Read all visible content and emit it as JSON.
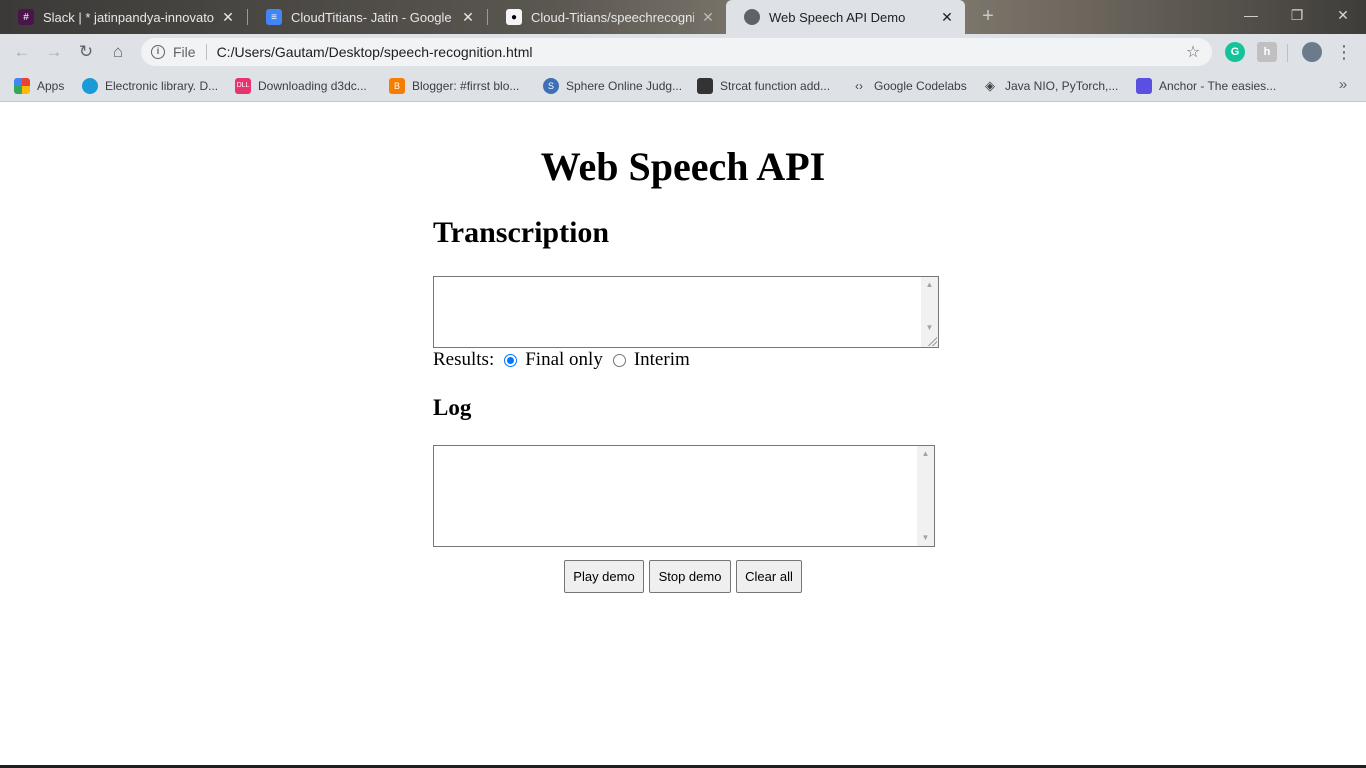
{
  "browser": {
    "tabs": [
      {
        "title": "Slack | * jatinpandya-innovator | C",
        "favicon": "slack-icon"
      },
      {
        "title": "CloudTitians- Jatin - Google Docs",
        "favicon": "google-docs-icon"
      },
      {
        "title": "Cloud-Titians/speechrecognition",
        "favicon": "github-icon"
      },
      {
        "title": "Web Speech API Demo",
        "favicon": "globe-icon"
      }
    ],
    "address": {
      "scheme_label": "File",
      "url": "C:/Users/Gautam/Desktop/speech-recognition.html"
    },
    "bookmarks": [
      {
        "label": "Apps",
        "icon": "apps-grid-icon"
      },
      {
        "label": "Electronic library. D...",
        "icon": "library-icon"
      },
      {
        "label": "Downloading d3dc...",
        "icon": "dll-icon"
      },
      {
        "label": "Blogger: #firrst blo...",
        "icon": "blogger-icon"
      },
      {
        "label": "Sphere Online Judg...",
        "icon": "spoj-icon"
      },
      {
        "label": "Strcat function add...",
        "icon": "code-book-icon"
      },
      {
        "label": "Google Codelabs",
        "icon": "codelabs-icon"
      },
      {
        "label": "Java NIO, PyTorch,...",
        "icon": "diamond-icon"
      },
      {
        "label": "Anchor - The easies...",
        "icon": "anchor-icon"
      }
    ],
    "favicon_glyphs": {
      "google_docs": "≡",
      "dll": "DLL",
      "blogger": "B",
      "spoj": "S"
    }
  },
  "page": {
    "title": "Web Speech API",
    "transcription_heading": "Transcription",
    "results_label": "Results:",
    "results_options": [
      {
        "label": "Final only",
        "checked": true
      },
      {
        "label": "Interim",
        "checked": false
      }
    ],
    "log_heading": "Log",
    "buttons": {
      "play": "Play demo",
      "stop": "Stop demo",
      "clear": "Clear all"
    }
  },
  "colors": {
    "tab_active": "#dee1e6",
    "radio_accent": "#0075ff"
  }
}
